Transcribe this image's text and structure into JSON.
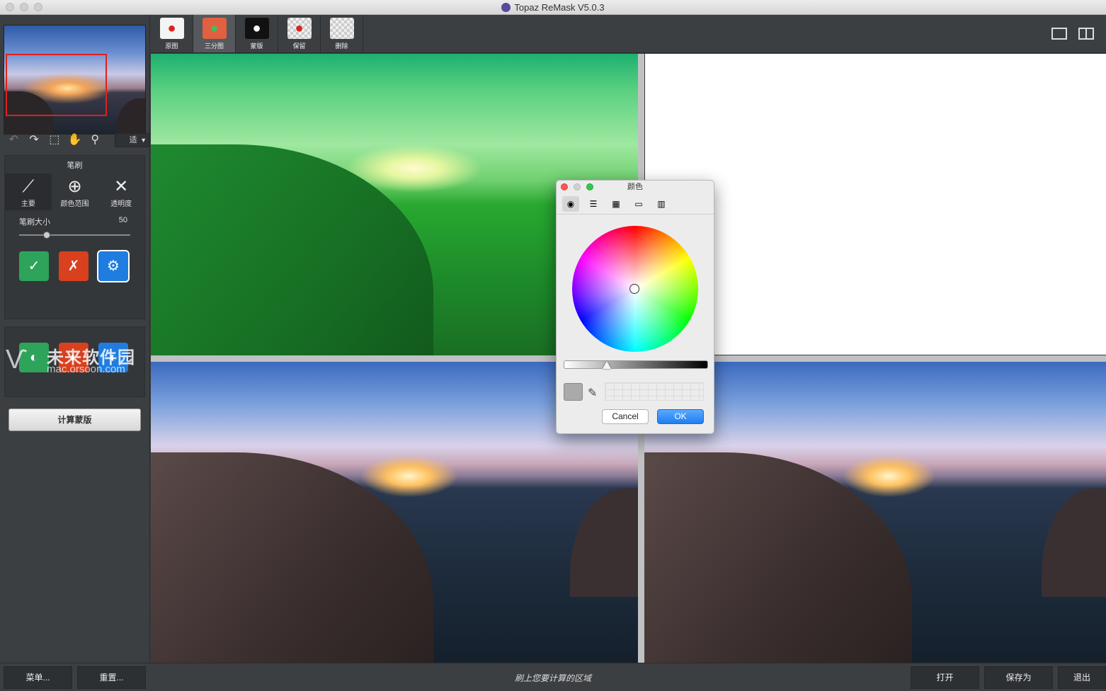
{
  "window": {
    "title": "Topaz ReMask V5.0.3"
  },
  "toolbar": {
    "tabs": [
      {
        "label": "原图",
        "icon": "apple-icon"
      },
      {
        "label": "三分图",
        "icon": "tri-map-icon"
      },
      {
        "label": "蒙版",
        "icon": "mask-icon"
      },
      {
        "label": "保留",
        "icon": "keep-icon"
      },
      {
        "label": "删除",
        "icon": "delete-icon"
      }
    ],
    "active_tab": "三分图"
  },
  "sidebar": {
    "zoom_value": "适",
    "brush_panel_title": "笔刷",
    "brush_modes": [
      "主要",
      "颜色范围",
      "透明度"
    ],
    "brush_size_label": "笔刷大小",
    "brush_size_value": "50",
    "compute_button": "计算蒙版"
  },
  "watermark": {
    "main": "未来软件园",
    "sub": "mac.orsoon.com"
  },
  "color_picker": {
    "title": "颜色",
    "cancel": "Cancel",
    "ok": "OK",
    "selected_color": "#aaaaaa"
  },
  "bottom": {
    "menu": "菜单...",
    "reset": "重置...",
    "status": "刷上您要计算的区域",
    "open": "打开",
    "save_as": "保存为",
    "exit": "退出"
  },
  "colors": {
    "accent": "#1f7ef2",
    "keep": "#2ea35a",
    "drop": "#d8401e",
    "compute": "#1f7de0"
  }
}
